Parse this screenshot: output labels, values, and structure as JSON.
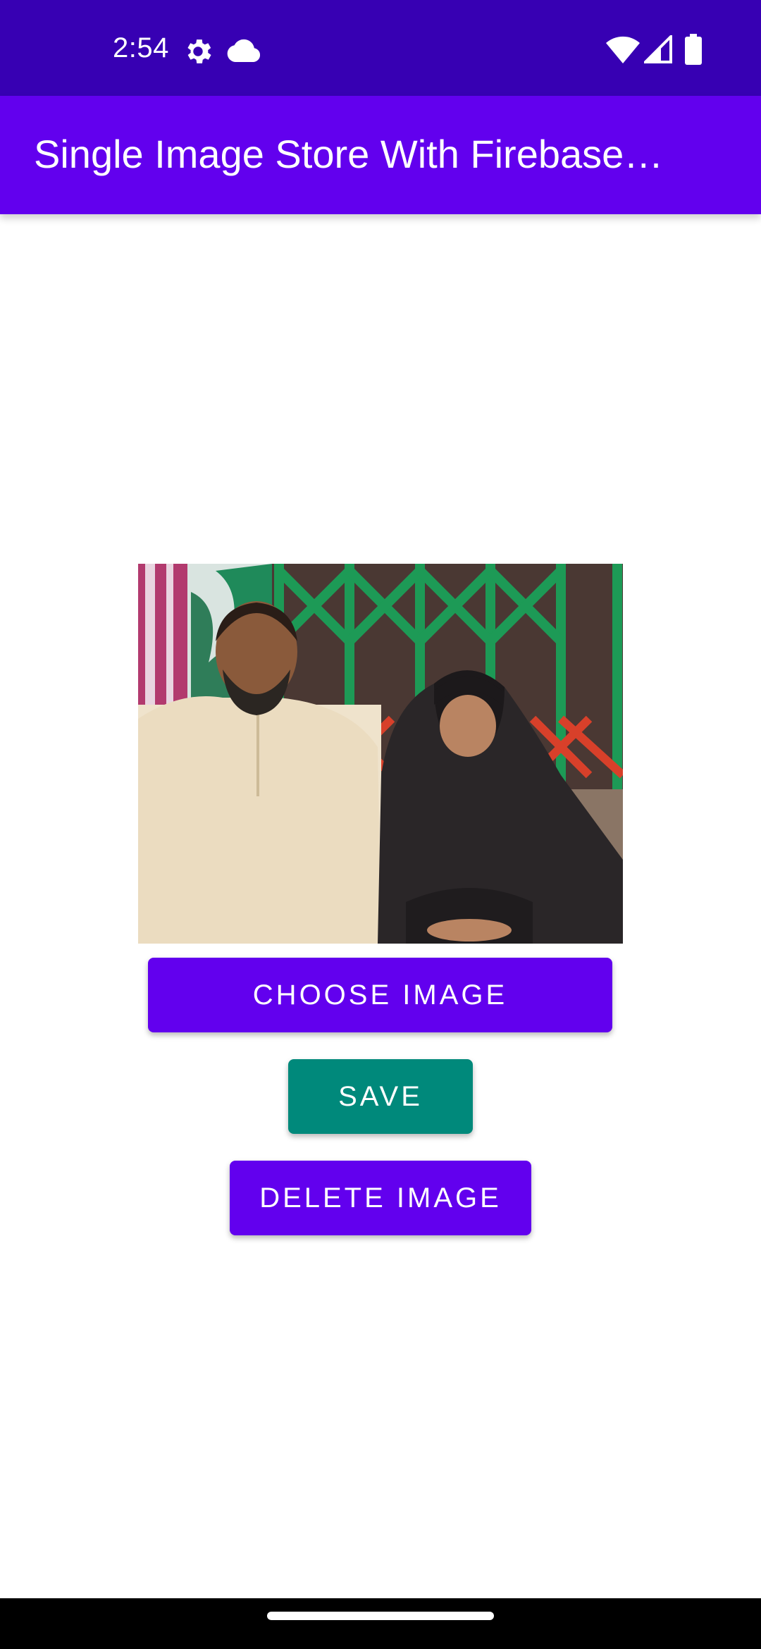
{
  "status_bar": {
    "time": "2:54",
    "icons": [
      "settings-gear-icon",
      "cloud-icon",
      "wifi-icon",
      "cell-signal-icon",
      "battery-icon"
    ]
  },
  "app_bar": {
    "title": "Single Image Store With Firebase…"
  },
  "image": {
    "description_icon": "photo-of-two-people"
  },
  "buttons": {
    "choose_label": "CHOOSE IMAGE",
    "save_label": "SAVE",
    "delete_label": "DELETE IMAGE"
  },
  "colors": {
    "status_bar": "#3700b3",
    "app_bar": "#6200ee",
    "primary_button": "#6200ee",
    "save_button": "#00897b"
  }
}
